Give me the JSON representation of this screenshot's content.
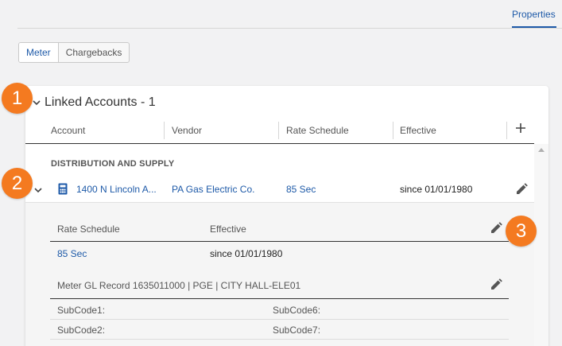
{
  "top_tabs": {
    "properties": "Properties"
  },
  "segments": {
    "meter": "Meter",
    "chargebacks": "Chargebacks"
  },
  "card": {
    "title": "Linked Accounts - 1",
    "columns": {
      "account": "Account",
      "vendor": "Vendor",
      "rate_schedule": "Rate Schedule",
      "effective": "Effective"
    }
  },
  "group": {
    "label": "DISTRIBUTION AND SUPPLY"
  },
  "account_row": {
    "account": "1400 N Lincoln A...",
    "vendor": "PA Gas Electric Co.",
    "rate_schedule": "85 Sec",
    "effective": "since 01/01/1980"
  },
  "detail": {
    "rate_header": "Rate Schedule",
    "effective_header": "Effective",
    "rate_value": "85 Sec",
    "effective_value": "since 01/01/1980",
    "gl_title": "Meter GL Record 1635011000 | PGE | CITY HALL-ELE01",
    "subcodes": {
      "s1": "SubCode1:",
      "s2": "SubCode2:",
      "s6": "SubCode6:",
      "s7": "SubCode7:"
    }
  },
  "badges": {
    "b1": "1",
    "b2": "2",
    "b3": "3"
  },
  "colors": {
    "accent": "#1e5aa8",
    "badge": "#f47a20"
  },
  "icons": [
    "chevron-down-icon",
    "plus-icon",
    "calculator-icon",
    "pencil-icon",
    "scroll-up-icon"
  ]
}
